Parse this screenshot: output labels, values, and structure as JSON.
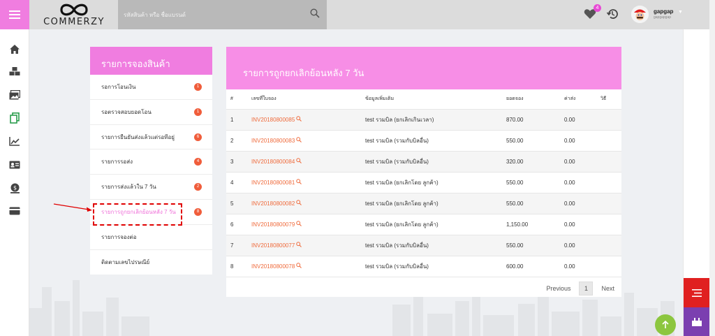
{
  "header": {
    "logo_text": "COMMERZY",
    "search_placeholder": "รหัสสินค้า หรือ ชื่อแบรนด์",
    "wishlist_count": "4",
    "user_name": "gapgap",
    "user_sub": "gapgapgap"
  },
  "menu": {
    "title": "รายการจองสินค้า",
    "items": [
      {
        "label": "รอการโอนเงิน",
        "badge": "1"
      },
      {
        "label": "รอตรวจสอบยอดโอน",
        "badge": "1"
      },
      {
        "label": "รายการยืนยันส่งแล้วแต่รอทีอยู่",
        "badge": "6"
      },
      {
        "label": "รายการรอส่ง",
        "badge": "4"
      },
      {
        "label": "รายการส่งแล้วใน 7 วัน",
        "badge": "2"
      },
      {
        "label": "รายการถูกยกเลิกย้อนหลัง 7 วัน",
        "badge": "8"
      },
      {
        "label": "รายการจองต่อ",
        "badge": ""
      },
      {
        "label": "ติดตามเลขไปรษณีย์",
        "badge": ""
      }
    ]
  },
  "main": {
    "title": "รายการถูกยกเลิกย้อนหลัง 7 วัน",
    "columns": [
      "#",
      "เลขที่ใบจอง",
      "ข้อมูลเพิ่มเติม",
      "ยอดจอง",
      "ค่าส่ง",
      "วิธี"
    ],
    "rows": [
      {
        "no": "1",
        "invoice": "INV20180800085",
        "info": "test รวมบิล (ยกเลิกเกินเวลา)",
        "amount": "870.00",
        "shipping": "0.00"
      },
      {
        "no": "2",
        "invoice": "INV20180800083",
        "info": "test รวมบิล (รวมกับบิลอื่น)",
        "amount": "550.00",
        "shipping": "0.00"
      },
      {
        "no": "3",
        "invoice": "INV20180800084",
        "info": "test รวมบิล (รวมกับบิลอื่น)",
        "amount": "320.00",
        "shipping": "0.00"
      },
      {
        "no": "4",
        "invoice": "INV20180800081",
        "info": "test รวมบิล (ยกเลิกโดย ลูกค้า)",
        "amount": "550.00",
        "shipping": "0.00"
      },
      {
        "no": "5",
        "invoice": "INV20180800082",
        "info": "test รวมบิล (ยกเลิกโดย ลูกค้า)",
        "amount": "550.00",
        "shipping": "0.00"
      },
      {
        "no": "6",
        "invoice": "INV20180800079",
        "info": "test รวมบิล (ยกเลิกโดย ลูกค้า)",
        "amount": "1,150.00",
        "shipping": "0.00"
      },
      {
        "no": "7",
        "invoice": "INV20180800077",
        "info": "test รวมบิล (รวมกับบิลอื่น)",
        "amount": "550.00",
        "shipping": "0.00"
      },
      {
        "no": "8",
        "invoice": "INV20180800078",
        "info": "test รวมบิล (รวมกับบิลอื่น)",
        "amount": "600.00",
        "shipping": "0.00"
      }
    ],
    "pager": {
      "previous": "Previous",
      "current": "1",
      "next": "Next"
    }
  },
  "sidebar_icons": [
    "home-icon",
    "boxes-icon",
    "photos-icon",
    "copy-icon",
    "chart-icon",
    "id-card-icon",
    "money-icon",
    "credit-card-icon"
  ],
  "colors": {
    "accent_pink": "#f07de0",
    "invoice_orange": "#ef6a3b",
    "badge_orange": "#f05d3b",
    "fab_red": "#e02020",
    "fab_purple": "#7b3fb0",
    "fab_green": "#8cc63f"
  }
}
